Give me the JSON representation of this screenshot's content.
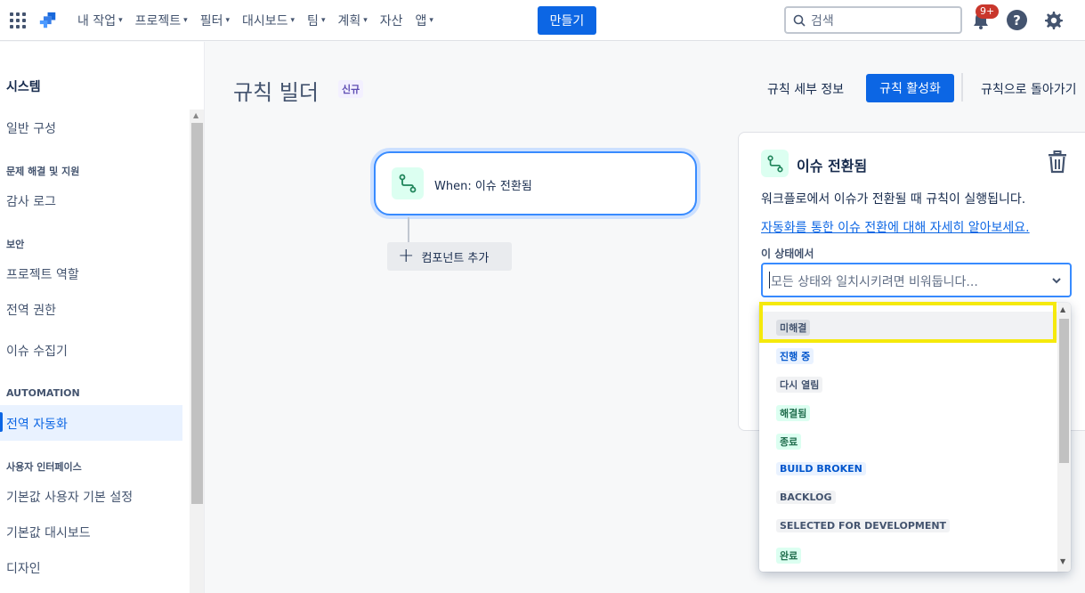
{
  "topnav": {
    "items": [
      {
        "label": "내 작업"
      },
      {
        "label": "프로젝트"
      },
      {
        "label": "필터"
      },
      {
        "label": "대시보드"
      },
      {
        "label": "팀"
      },
      {
        "label": "계획"
      },
      {
        "label": "자산",
        "no_chevron": true
      },
      {
        "label": "앱"
      }
    ],
    "create_label": "만들기",
    "search_placeholder": "검색",
    "notification_badge": "9+"
  },
  "sidebar": {
    "title": "시스템",
    "general": "일반 구성",
    "sections": {
      "troubleshooting": "문제 해결 및 지원",
      "audit_log": "감사 로그",
      "security": "보안",
      "project_roles": "프로젝트 역할",
      "global_permissions": "전역 권한",
      "issue_collectors": "이슈 수집기",
      "automation": "AUTOMATION",
      "global_automation": "전역 자동화",
      "user_interface": "사용자 인터페이스",
      "default_user_prefs": "기본값 사용자 기본 설정",
      "default_dashboard": "기본값 대시보드",
      "design": "디자인"
    }
  },
  "main": {
    "title": "규칙 빌더",
    "new_lozenge": "신규",
    "rule_details": "규칙 세부 정보",
    "activate": "규칙 활성화",
    "back": "규칙으로 돌아가기",
    "trigger_label": "When: 이슈 전환됨",
    "add_component": "컴포넌트 추가"
  },
  "panel": {
    "title": "이슈 전환됨",
    "description": "워크플로에서 이슈가 전환될 때 규칙이 실행됩니다.",
    "learn_more": "자동화를 통한 이슈 전환에 대해 자세히 알아보세요.",
    "from_status_label": "이 상태에서",
    "select_placeholder": "모든 상태와 일치시키려면 비워둡니다..."
  },
  "dropdown": {
    "options": [
      {
        "label": "미해결",
        "style": "gray-dark"
      },
      {
        "label": "진행 중",
        "style": "blue"
      },
      {
        "label": "다시 열림",
        "style": "gray"
      },
      {
        "label": "해결됨",
        "style": "green"
      },
      {
        "label": "종료",
        "style": "green"
      },
      {
        "label": "BUILD BROKEN",
        "style": "blue"
      },
      {
        "label": "BACKLOG",
        "style": "gray"
      },
      {
        "label": "SELECTED FOR DEVELOPMENT",
        "style": "gray"
      },
      {
        "label": "완료",
        "style": "green"
      }
    ],
    "highlighted_index": 0
  },
  "colors": {
    "primary": "#0c66e4",
    "highlight_box": "#f5e90c"
  }
}
